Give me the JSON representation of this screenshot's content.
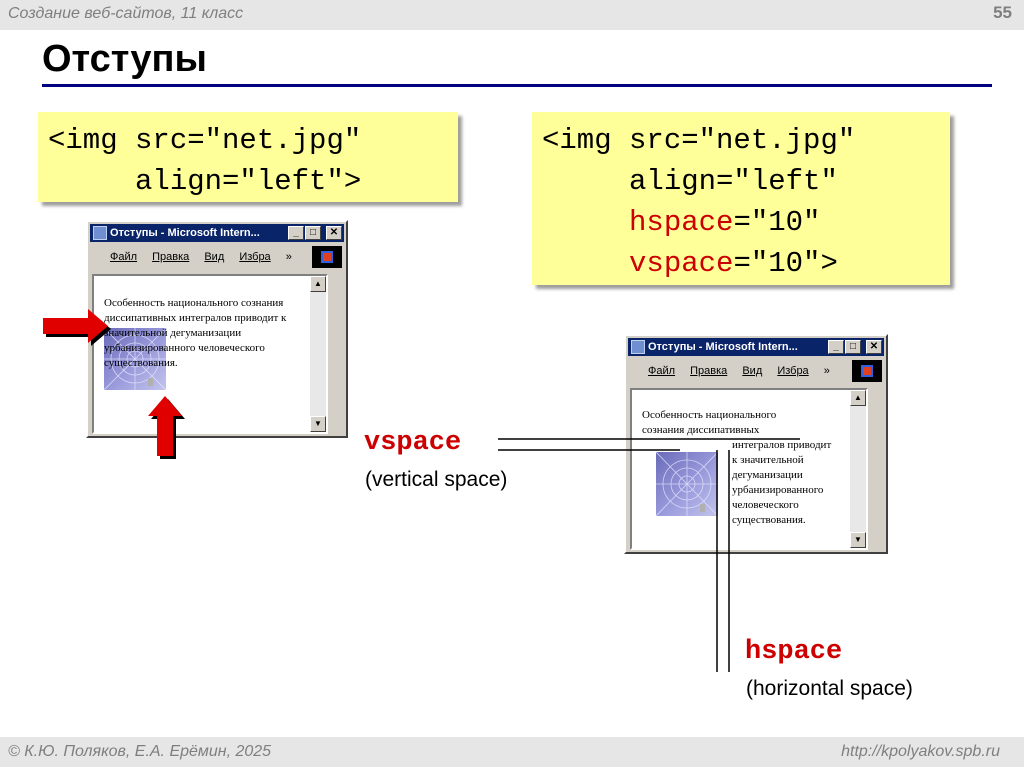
{
  "header": {
    "course": "Создание веб-сайтов, 11 класс",
    "page_number": "55"
  },
  "slide_title": "Отступы",
  "code_left": {
    "line1": "<img src=\"net.jpg\"",
    "line2": "     align=\"left\">"
  },
  "code_right": {
    "line1": "<img src=\"net.jpg\"",
    "line2": "     align=\"left\"",
    "hspace_attr": "hspace",
    "hspace_val": "=\"10\"",
    "vspace_attr": "vspace",
    "vspace_val": "=\"10\">"
  },
  "window_left": {
    "title": "Отступы - Microsoft Intern...",
    "menu": {
      "file": "Файл",
      "edit": "Правка",
      "view": "Вид",
      "fav": "Избра",
      "more": "»"
    },
    "para": "Особенность национального сознания диссипативных интегралов приводит к значительной дегуманизации урбанизированного человеческого существования."
  },
  "window_right": {
    "title": "Отступы - Microsoft Intern...",
    "menu": {
      "file": "Файл",
      "edit": "Правка",
      "view": "Вид",
      "fav": "Избра",
      "more": "»"
    },
    "line1": "Особенность национального",
    "line2": "сознания диссипативных",
    "wrap": [
      "интегралов приводит",
      "к значительной",
      "дегуманизации",
      "урбанизированного",
      "человеческого",
      "существования."
    ]
  },
  "labels": {
    "vspace": "vspace",
    "vspace_desc": "(vertical space)",
    "hspace": "hspace",
    "hspace_desc": "(horizontal space)"
  },
  "footer": {
    "authors": "© К.Ю. Поляков, Е.А. Ерёмин, 2025",
    "site": "http://kpolyakov.spb.ru"
  },
  "colors": {
    "accent": "#cc0000",
    "title_rule": "#000080",
    "code_bg": "#ffff99",
    "arrow": "#e00000"
  }
}
